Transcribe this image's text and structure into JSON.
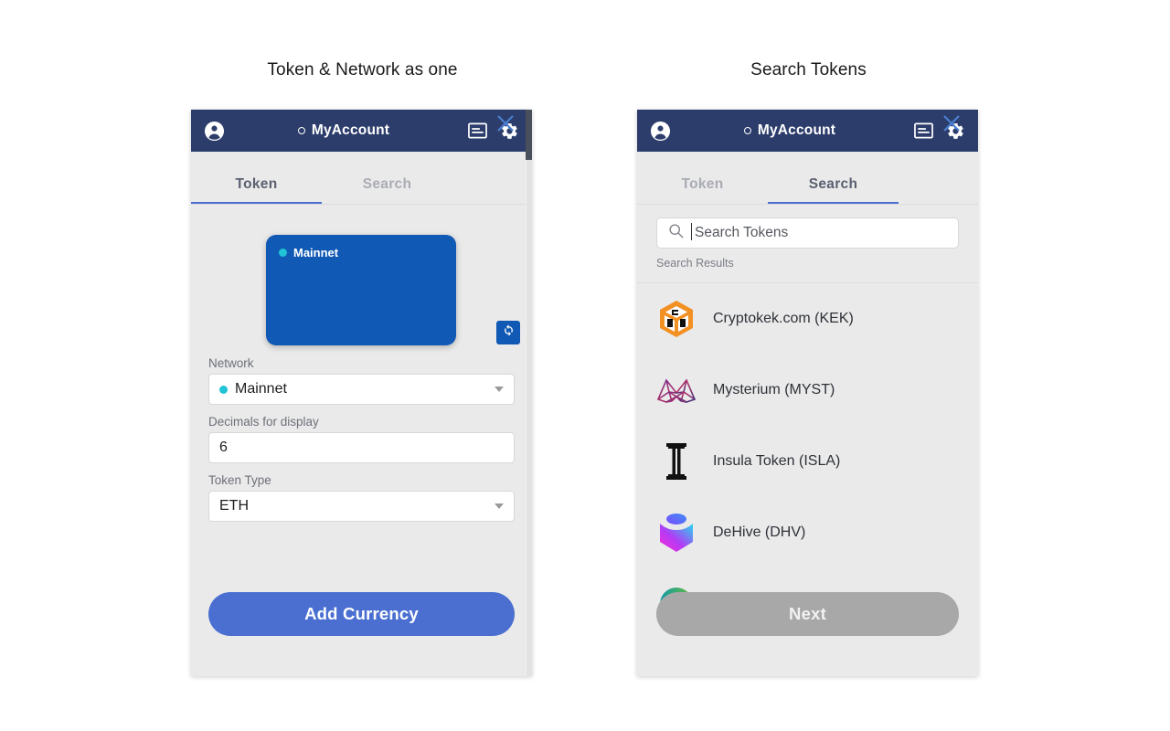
{
  "captions": {
    "left": "Token & Network as one",
    "right": "Search Tokens"
  },
  "colors": {
    "header_blue": "#2c3d6b",
    "panel_bg": "#eaeaea",
    "accent_blue": "#4a6fd1",
    "card_blue": "#1059b4",
    "teal_dot": "#21c3d6",
    "disabled_grey": "#a8a8a8"
  },
  "header": {
    "account_label": "MyAccount",
    "avatar_icon": "account-circle-icon",
    "card_icon": "card-icon",
    "settings_icon": "gear-icon"
  },
  "left_panel": {
    "tabs": [
      {
        "label": "Token",
        "active": true
      },
      {
        "label": "Search",
        "active": false
      }
    ],
    "close_icon": "close-icon",
    "network_card": {
      "label": "Mainnet",
      "status_dot": "status-dot-teal"
    },
    "refresh_icon": "refresh-icon",
    "fields": [
      {
        "label": "Network",
        "value": "Mainnet",
        "type": "select",
        "has_dot": true
      },
      {
        "label": "Decimals for display",
        "value": "6",
        "type": "text",
        "has_dot": false
      },
      {
        "label": "Token Type",
        "value": "ETH",
        "type": "select",
        "has_dot": false
      }
    ],
    "primary_button": "Add Currency"
  },
  "right_panel": {
    "tabs": [
      {
        "label": "Token",
        "active": false
      },
      {
        "label": "Search",
        "active": true
      }
    ],
    "close_icon": "close-icon",
    "search": {
      "placeholder": "Search Tokens",
      "value": "",
      "icon": "search-icon"
    },
    "results_label": "Search Results",
    "results": [
      {
        "name": "Cryptokek.com (KEK)",
        "logo": "cryptokek-cube-logo"
      },
      {
        "name": "Mysterium (MYST)",
        "logo": "mysterium-m-logo"
      },
      {
        "name": "Insula Token (ISLA)",
        "logo": "insula-column-logo"
      },
      {
        "name": "DeHive (DHV)",
        "logo": "dehive-hex-logo"
      },
      {
        "name": "",
        "logo": "teal-green-circle-logo"
      }
    ],
    "primary_button": "Next"
  }
}
